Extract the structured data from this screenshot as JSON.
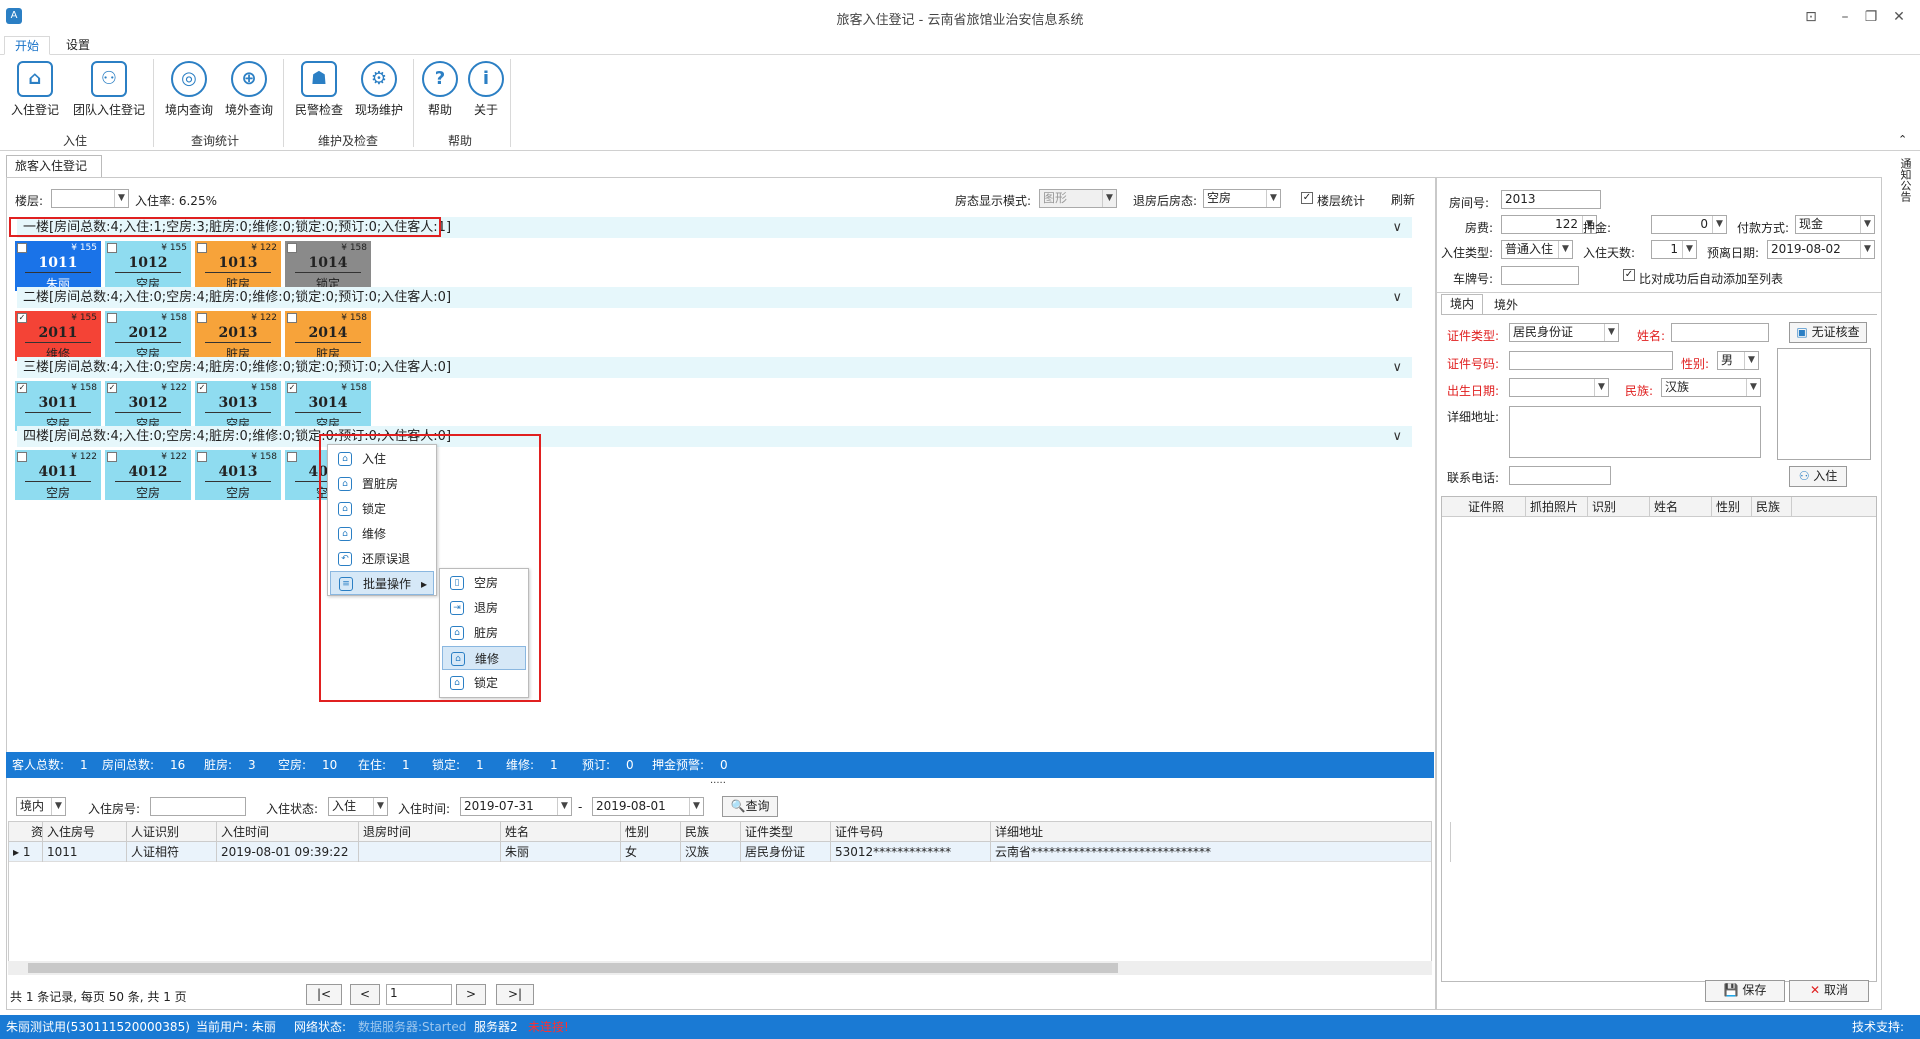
{
  "window": {
    "title": "旅客入住登记 - 云南省旅馆业治安信息系统"
  },
  "ribbon": {
    "tabs": [
      "开始",
      "设置"
    ],
    "buttons": [
      "入住登记",
      "团队入住登记",
      "境内查询",
      "境外查询",
      "民警检查",
      "现场维护",
      "帮助",
      "关于"
    ],
    "groups": [
      "入住",
      "查询统计",
      "维护及检查",
      "帮助"
    ]
  },
  "doctab": "旅客入住登记",
  "toolbar": {
    "floor_label": "楼层:",
    "occupancy": "入住率: 6.25%",
    "display_mode_label": "房态显示模式:",
    "display_mode": "图形",
    "after_checkout_label": "退房后房态:",
    "after_checkout": "空房",
    "floor_stats": "楼层统计",
    "refresh": "刷新"
  },
  "floors": [
    {
      "title": "一楼[房间总数:4;入住:1;空房:3;脏房:0;维修:0;锁定:0;预订:0;入住客人:1]",
      "rooms": [
        {
          "num": "1011",
          "price": "¥ 155",
          "status": "朱丽",
          "color": "#1a73e8",
          "fg": "#fff"
        },
        {
          "num": "1012",
          "price": "¥ 155",
          "status": "空房",
          "color": "#8fdcf0",
          "fg": "#222"
        },
        {
          "num": "1013",
          "price": "¥ 122",
          "status": "脏房",
          "color": "#f7a33a",
          "fg": "#222"
        },
        {
          "num": "1014",
          "price": "¥ 158",
          "status": "锁定",
          "color": "#8a8a8a",
          "fg": "#222"
        }
      ]
    },
    {
      "title": "二楼[房间总数:4;入住:0;空房:4;脏房:0;维修:0;锁定:0;预订:0;入住客人:0]",
      "rooms": [
        {
          "num": "2011",
          "price": "¥ 155",
          "status": "维修",
          "color": "#f44336",
          "fg": "#222"
        },
        {
          "num": "2012",
          "price": "¥ 158",
          "status": "空房",
          "color": "#8fdcf0",
          "fg": "#222"
        },
        {
          "num": "2013",
          "price": "¥ 122",
          "status": "脏房",
          "color": "#f7a33a",
          "fg": "#222"
        },
        {
          "num": "2014",
          "price": "¥ 158",
          "status": "脏房",
          "color": "#f7a33a",
          "fg": "#222"
        }
      ]
    },
    {
      "title": "三楼[房间总数:4;入住:0;空房:4;脏房:0;维修:0;锁定:0;预订:0;入住客人:0]",
      "rooms": [
        {
          "num": "3011",
          "price": "¥ 158",
          "status": "空房",
          "color": "#8fdcf0",
          "fg": "#222"
        },
        {
          "num": "3012",
          "price": "¥ 122",
          "status": "空房",
          "color": "#8fdcf0",
          "fg": "#222"
        },
        {
          "num": "3013",
          "price": "¥ 158",
          "status": "空房",
          "color": "#8fdcf0",
          "fg": "#222"
        },
        {
          "num": "3014",
          "price": "¥ 158",
          "status": "空房",
          "color": "#8fdcf0",
          "fg": "#222"
        }
      ]
    },
    {
      "title": "四楼[房间总数:4;入住:0;空房:4;脏房:0;维修:0;锁定:0;预订:0;入住客人:0]",
      "rooms": [
        {
          "num": "4011",
          "price": "¥ 122",
          "status": "空房",
          "color": "#8fdcf0",
          "fg": "#222"
        },
        {
          "num": "4012",
          "price": "¥ 122",
          "status": "空房",
          "color": "#8fdcf0",
          "fg": "#222"
        },
        {
          "num": "4013",
          "price": "¥ 158",
          "status": "空房",
          "color": "#8fdcf0",
          "fg": "#222"
        },
        {
          "num": "4014",
          "price": "¥ 158",
          "status": "空房",
          "color": "#8fdcf0",
          "fg": "#222"
        }
      ]
    }
  ],
  "context_menu": [
    "入住",
    "置脏房",
    "锁定",
    "维修",
    "还原误退",
    "批量操作"
  ],
  "submenu": [
    "空房",
    "退房",
    "脏房",
    "维修",
    "锁定"
  ],
  "stats": [
    [
      "客人总数:",
      "1"
    ],
    [
      "房间总数:",
      "16"
    ],
    [
      "脏房:",
      "3"
    ],
    [
      "空房:",
      "10"
    ],
    [
      "在住:",
      "1"
    ],
    [
      "锁定:",
      "1"
    ],
    [
      "维修:",
      "1"
    ],
    [
      "预订:",
      "0"
    ],
    [
      "押金预警:",
      "0"
    ]
  ],
  "query": {
    "scope": "境内",
    "room_label": "入住房号:",
    "state_label": "入住状态:",
    "state": "入住",
    "time_label": "入住时间:",
    "from": "2019-07-31",
    "to": "2019-08-01",
    "search": "查询"
  },
  "grid": {
    "headers": [
      "资",
      "入住房号",
      "人证识别",
      "入住时间",
      "退房时间",
      "姓名",
      "性别",
      "民族",
      "证件类型",
      "证件号码",
      "详细地址"
    ],
    "rows": [
      [
        "1",
        "1011",
        "人证相符",
        "2019-08-01 09:39:22",
        "",
        "朱丽",
        "女",
        "汉族",
        "居民身份证",
        "53012*************",
        "云南省******************************"
      ]
    ]
  },
  "pager": {
    "info": "共 1 条记录, 每页 50 条, 共 1 页",
    "first": "|<",
    "prev": "<",
    "page": "1",
    "next": ">",
    "last": ">|"
  },
  "right": {
    "room_label": "房间号:",
    "room": "2013",
    "fee_label": "房费:",
    "fee": "122",
    "deposit_label": "押金:",
    "deposit": "0",
    "pay_label": "付款方式:",
    "pay": "现金",
    "type_label": "入住类型:",
    "type": "普通入住",
    "days_label": "入住天数:",
    "days": "1",
    "leave_label": "预离日期:",
    "leave": "2019-08-02",
    "plate_label": "车牌号:",
    "auto_add": "比对成功后自动添加至列表",
    "tabs": [
      "境内",
      "境外"
    ],
    "id_type_label": "证件类型:",
    "id_type": "居民身份证",
    "name_label": "姓名:",
    "no_id_btn": "无证核查",
    "id_no_label": "证件号码:",
    "sex_label": "性别:",
    "sex": "男",
    "birth_label": "出生日期:",
    "ethnic_label": "民族:",
    "ethnic": "汉族",
    "addr_label": "详细地址:",
    "phone_label": "联系电话:",
    "checkin_btn": "入住",
    "list_headers": [
      "证件照",
      "抓拍照片",
      "识别",
      "姓名",
      "性别",
      "民族"
    ],
    "save": "保存",
    "cancel": "取消",
    "side_tab": "通知公告"
  },
  "statusbar": {
    "user": "朱丽测试用(530111520000385)",
    "current_user": "当前用户: 朱丽",
    "network": "网络状态:",
    "data_server": "数据服务器:Started",
    "server2": "服务器2",
    "server2_state": "未连接!",
    "support": "技术支持:"
  }
}
